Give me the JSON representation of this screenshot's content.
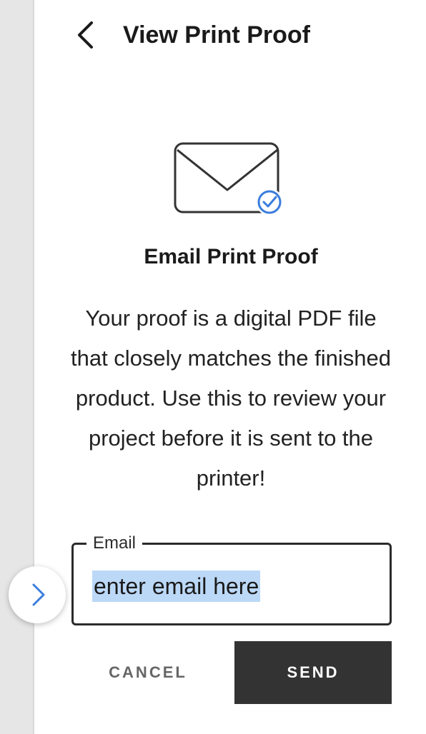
{
  "header": {
    "title": "View Print Proof",
    "back_icon": "chevron-left-icon"
  },
  "illustration": {
    "icon": "envelope-check-icon",
    "accent_color": "#3b7ddd"
  },
  "section": {
    "title": "Email Print Proof",
    "description": "Your proof is a digital PDF file that closely matches the finished product. Use this to review your project before it is sent to the printer!"
  },
  "email_field": {
    "label": "Email",
    "value": "enter email here"
  },
  "actions": {
    "cancel_label": "CANCEL",
    "send_label": "SEND"
  },
  "sidebar_toggle": {
    "icon": "chevron-right-icon",
    "color": "#3b7ddd"
  }
}
